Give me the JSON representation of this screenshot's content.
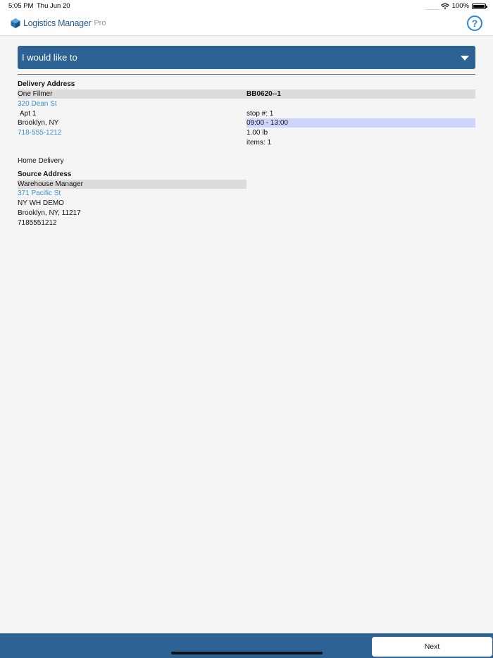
{
  "status_bar": {
    "time": "5:05 PM",
    "date": "Thu Jun 20",
    "battery": "100%"
  },
  "header": {
    "logo_text": "Logistics Manager",
    "logo_suffix": "Pro",
    "help_label": "?"
  },
  "action_dropdown": {
    "label": "I would like to"
  },
  "delivery": {
    "heading": "Delivery Address",
    "name": "One Filmer",
    "street": "320 Dean St",
    "unit": "Apt 1",
    "city": "Brooklyn, NY",
    "phone": "718-555-1212",
    "type": "Home Delivery"
  },
  "order": {
    "id": "BB0620--1",
    "stop": "stop #: 1",
    "time_window": "09:00 - 13:00",
    "weight": "1.00 lb",
    "items": "items: 1"
  },
  "source": {
    "heading": "Source Address",
    "name": "Warehouse Manager",
    "street": "371 Pacific St",
    "warehouse": "NY WH DEMO",
    "city": "Brooklyn, NY, 11217",
    "phone": "7185551212"
  },
  "footer": {
    "next_label": "Next"
  },
  "colors": {
    "primary": "#2c6394",
    "link": "#3a8fcf",
    "help": "#2a86de",
    "row_highlight": "#dcdcdc",
    "time_highlight": "#cdd6fa"
  },
  "icons": {
    "logo": "logistics-hexagon-logo",
    "help": "question-circle-icon",
    "dropdown": "caret-down-icon",
    "wifi": "wifi-icon",
    "battery": "battery-icon"
  }
}
